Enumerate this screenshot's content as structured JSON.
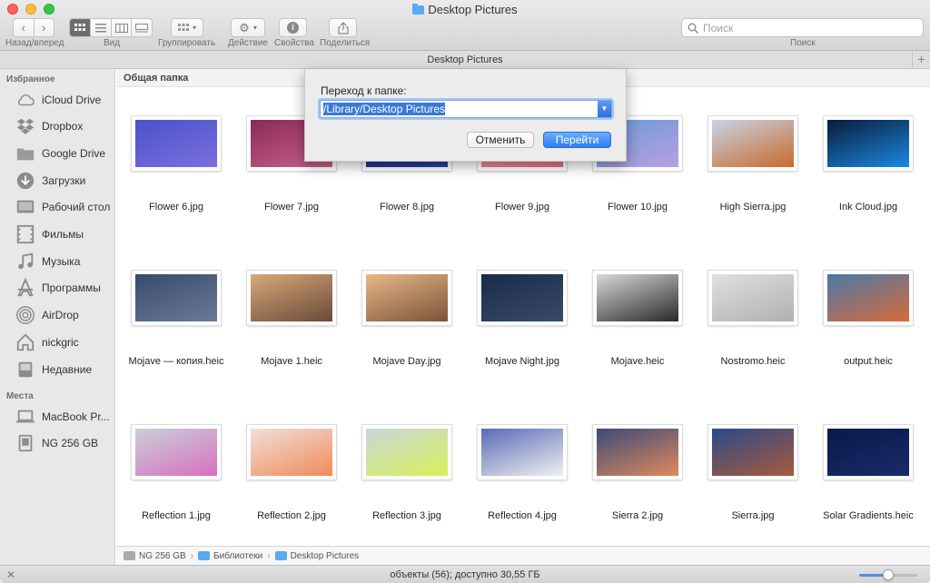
{
  "window": {
    "title": "Desktop Pictures"
  },
  "toolbar": {
    "back_forward_label": "Назад/вперед",
    "view_label": "Вид",
    "group_label": "Группировать",
    "action_label": "Действие",
    "properties_label": "Свойства",
    "share_label": "Поделиться",
    "search_label": "Поиск",
    "search_placeholder": "Поиск"
  },
  "tabbar": {
    "title": "Desktop Pictures"
  },
  "sidebar": {
    "favorites_header": "Избранное",
    "favorites": [
      {
        "label": "iCloud Drive",
        "icon": "cloud-icon"
      },
      {
        "label": "Dropbox",
        "icon": "dropbox-icon"
      },
      {
        "label": "Google Drive",
        "icon": "folder-icon"
      },
      {
        "label": "Загрузки",
        "icon": "downloads-icon"
      },
      {
        "label": "Рабочий стол",
        "icon": "desktop-icon"
      },
      {
        "label": "Фильмы",
        "icon": "movies-icon"
      },
      {
        "label": "Музыка",
        "icon": "music-icon"
      },
      {
        "label": "Программы",
        "icon": "applications-icon"
      },
      {
        "label": "AirDrop",
        "icon": "airdrop-icon"
      },
      {
        "label": "nickgric",
        "icon": "home-icon"
      },
      {
        "label": "Недавние",
        "icon": "recents-icon"
      }
    ],
    "places_header": "Места",
    "places": [
      {
        "label": "MacBook Pr...",
        "icon": "laptop-icon"
      },
      {
        "label": "NG 256 GB",
        "icon": "disk-icon"
      }
    ]
  },
  "main": {
    "group_header": "Общая папка",
    "files": [
      {
        "name": "Flower 6.jpg",
        "colors": [
          "#4a52c8",
          "#7b6fe0"
        ]
      },
      {
        "name": "Flower 7.jpg",
        "colors": [
          "#8a2a5a",
          "#c8608a"
        ]
      },
      {
        "name": "Flower 8.jpg",
        "colors": [
          "#1a2a7a",
          "#2b3d9e"
        ]
      },
      {
        "name": "Flower 9.jpg",
        "colors": [
          "#f0a0a8",
          "#e8707e"
        ]
      },
      {
        "name": "Flower 10.jpg",
        "colors": [
          "#6a9ad8",
          "#b8a0e0"
        ]
      },
      {
        "name": "High Sierra.jpg",
        "colors": [
          "#c8d4e8",
          "#c86a2a"
        ]
      },
      {
        "name": "Ink Cloud.jpg",
        "colors": [
          "#0a1a3a",
          "#1a8ae0"
        ]
      },
      {
        "name": "Mojave — копия.heic",
        "colors": [
          "#3a4a6a",
          "#6a7a9a"
        ]
      },
      {
        "name": "Mojave 1.heic",
        "colors": [
          "#d8a878",
          "#6a4a3a"
        ]
      },
      {
        "name": "Mojave Day.jpg",
        "colors": [
          "#e8b888",
          "#7a5438"
        ]
      },
      {
        "name": "Mojave Night.jpg",
        "colors": [
          "#1a2a4a",
          "#3a4a6a"
        ]
      },
      {
        "name": "Mojave.heic",
        "colors": [
          "#d8d8d8",
          "#2a2a2a"
        ]
      },
      {
        "name": "Nostromo.heic",
        "colors": [
          "#e0e0e0",
          "#b0b0b0"
        ]
      },
      {
        "name": "output.heic",
        "colors": [
          "#4a7aa8",
          "#d86a3a"
        ]
      },
      {
        "name": "Reflection 1.jpg",
        "colors": [
          "#c8d0d8",
          "#d870c0"
        ]
      },
      {
        "name": "Reflection 2.jpg",
        "colors": [
          "#f0e0d8",
          "#f08a5a"
        ]
      },
      {
        "name": "Reflection 3.jpg",
        "colors": [
          "#c8d8d8",
          "#d8f05a"
        ]
      },
      {
        "name": "Reflection 4.jpg",
        "colors": [
          "#5a6ab8",
          "#f0f0f0"
        ]
      },
      {
        "name": "Sierra 2.jpg",
        "colors": [
          "#3a4a7a",
          "#e08a5a"
        ]
      },
      {
        "name": "Sierra.jpg",
        "colors": [
          "#2a4a8a",
          "#a85a3a"
        ]
      },
      {
        "name": "Solar Gradients.heic",
        "colors": [
          "#0a1a4a",
          "#1a2a6a"
        ]
      }
    ]
  },
  "pathbar": {
    "disk": "NG 256 GB",
    "libraries": "Библиотеки",
    "folder": "Desktop Pictures"
  },
  "statusbar": {
    "text": "объекты (56); доступно 30,55 ГБ",
    "icon_size_level": 0.5
  },
  "goto_sheet": {
    "label": "Переход к папке:",
    "path_value": "/Library/Desktop Pictures/",
    "cancel_label": "Отменить",
    "go_label": "Перейти"
  }
}
